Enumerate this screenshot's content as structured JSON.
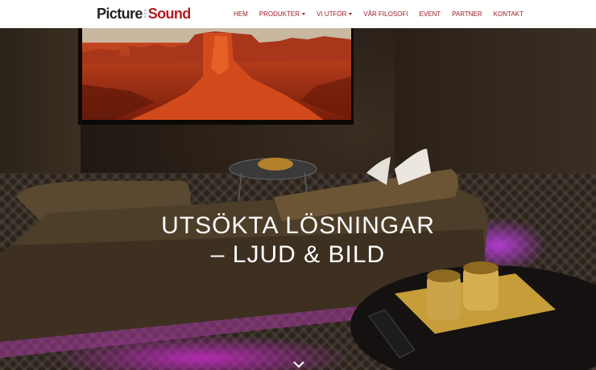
{
  "header": {
    "logo": {
      "word1": "Picture",
      "and_letters": [
        "A",
        "N",
        "D"
      ],
      "word2": "Sound"
    },
    "nav": [
      {
        "label": "HEM",
        "dropdown": false
      },
      {
        "label": "PRODUKTER",
        "dropdown": true
      },
      {
        "label": "VI UTFÖR",
        "dropdown": true
      },
      {
        "label": "VÅR FILOSOFI",
        "dropdown": false
      },
      {
        "label": "EVENT",
        "dropdown": false
      },
      {
        "label": "PARTNER",
        "dropdown": false
      },
      {
        "label": "KONTAKT",
        "dropdown": false
      }
    ]
  },
  "hero": {
    "title_line1": "UTSÖKTA LÖSNINGAR",
    "title_line2": "– LJUD & BILD",
    "scroll_icon": "chevron-down-icon"
  },
  "colors": {
    "brand_red": "#b01c22",
    "nav_text": "#9c1b22",
    "header_bg": "#ffffff"
  }
}
